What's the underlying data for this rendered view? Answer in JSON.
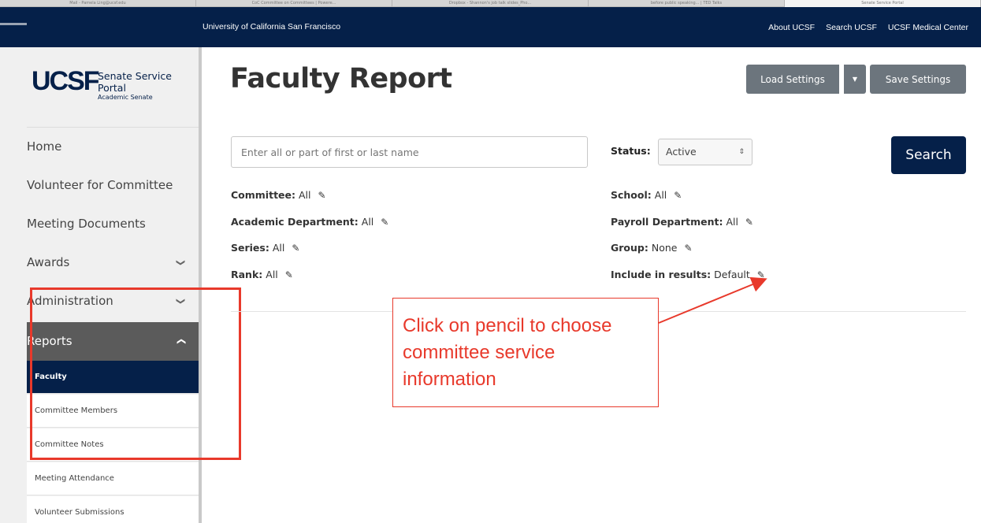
{
  "browser": {
    "tabs": [
      "Mail - Pamela Ling@ucsf.edu",
      "CoC Committee on Committees | Powere...",
      "Dropbox - Shannon's job talk slides_Pho...",
      "before public speaking... | TED Talks",
      "Senate Service Portal"
    ]
  },
  "topbar": {
    "university": "University of California San Francisco",
    "links": [
      "About UCSF",
      "Search UCSF",
      "UCSF Medical Center"
    ]
  },
  "logo": {
    "mark": "UCSF",
    "line1": "Senate Service",
    "line2": "Portal",
    "line3": "Academic Senate"
  },
  "sidebar": {
    "home": "Home",
    "volunteer": "Volunteer for Committee",
    "meeting_documents": "Meeting Documents",
    "awards": "Awards",
    "administration": "Administration",
    "reports": "Reports",
    "sub": {
      "faculty": "Faculty",
      "committee_members": "Committee Members",
      "committee_notes": "Committee Notes",
      "meeting_attendance": "Meeting Attendance",
      "volunteer_submissions": "Volunteer Submissions"
    }
  },
  "main": {
    "title": "Faculty Report",
    "load_settings": "Load Settings",
    "save_settings": "Save Settings",
    "search_placeholder": "Enter all or part of first or last name",
    "status_label": "Status:",
    "status_value": "Active",
    "search_button": "Search",
    "filters": {
      "committee": {
        "label": "Committee:",
        "value": "All"
      },
      "academic_department": {
        "label": "Academic Department:",
        "value": "All"
      },
      "series": {
        "label": "Series:",
        "value": "All"
      },
      "rank": {
        "label": "Rank:",
        "value": "All"
      },
      "school": {
        "label": "School:",
        "value": "All"
      },
      "payroll_department": {
        "label": "Payroll Department:",
        "value": "All"
      },
      "group": {
        "label": "Group:",
        "value": "None"
      },
      "include": {
        "label": "Include in results:",
        "value": "Default"
      }
    }
  },
  "annotation": {
    "text": "Click on pencil to choose committee service information",
    "color": "#e8392b"
  }
}
